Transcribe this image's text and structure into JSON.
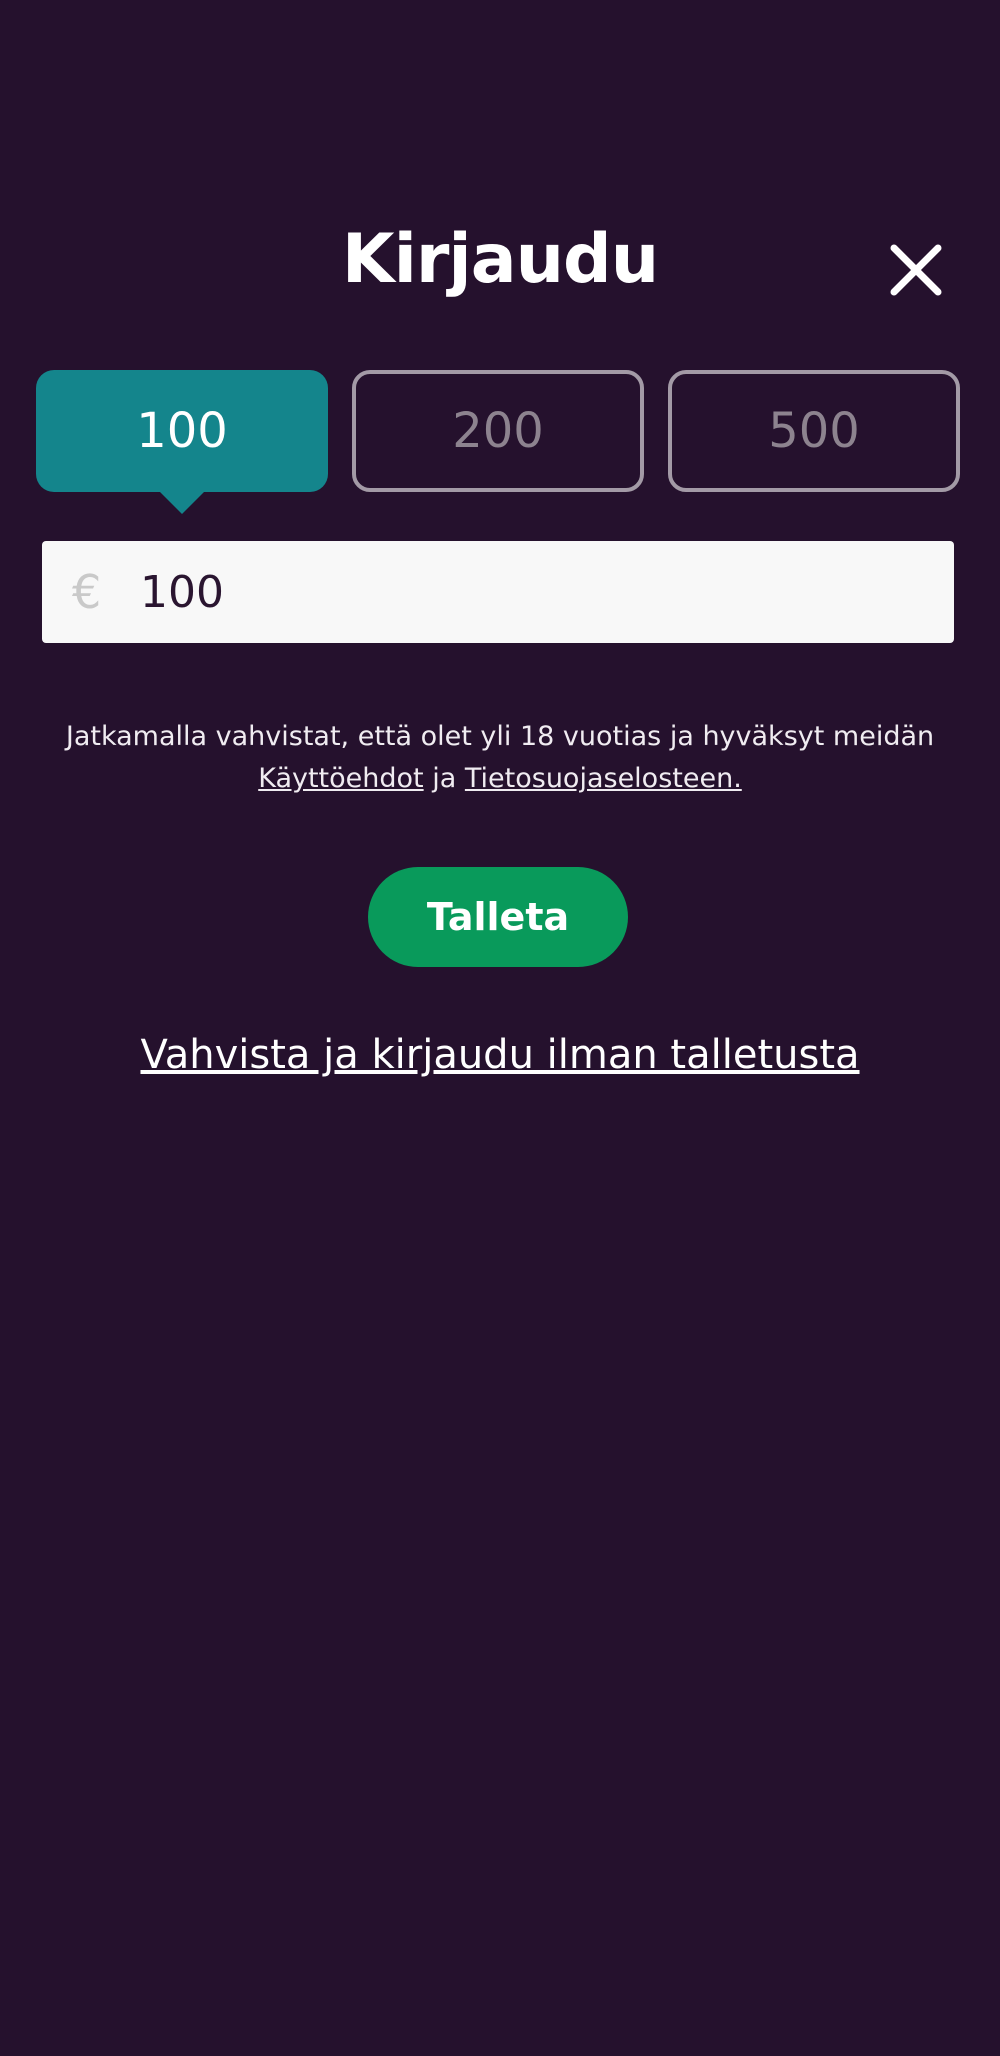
{
  "modal": {
    "title": "Kirjaudu",
    "close_icon": "close-icon"
  },
  "amount_options": [
    {
      "label": "100",
      "selected": true
    },
    {
      "label": "200",
      "selected": false
    },
    {
      "label": "500",
      "selected": false
    }
  ],
  "amount_input": {
    "currency_symbol": "€",
    "value": "100"
  },
  "terms": {
    "text_before": "Jatkamalla vahvistat, että olet yli 18 vuotias ja hyväksyt meidän",
    "terms_link": "Käyttöehdot",
    "conjunction": "ja",
    "privacy_link": "Tietosuojaselosteen."
  },
  "deposit_button": {
    "label": "Talleta"
  },
  "skip_link": {
    "label": "Vahvista ja kirjaudu ilman talletusta"
  },
  "colors": {
    "background": "#25112d",
    "selected_amount": "#14858c",
    "deposit_button": "#099a5b",
    "inactive_border": "#a39aa6"
  }
}
